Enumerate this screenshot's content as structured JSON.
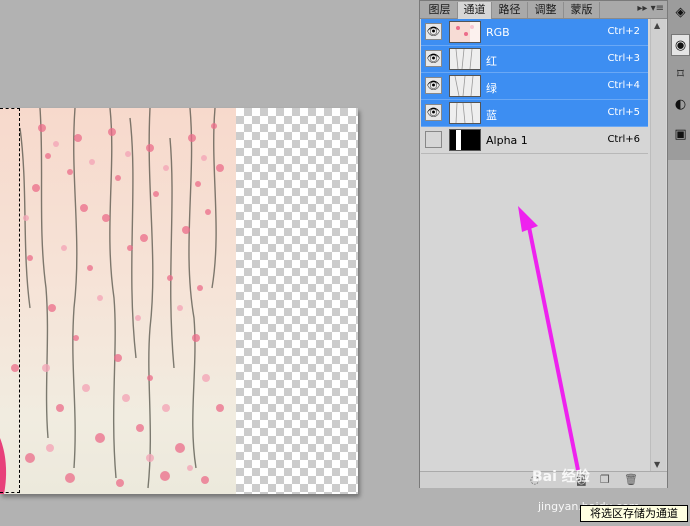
{
  "panel": {
    "tabs": [
      "图层",
      "通道",
      "路径",
      "调整",
      "蒙版"
    ],
    "active_tab": "通道",
    "menu_glyph": "▸▸ ▾≡",
    "channels": [
      {
        "name": "RGB",
        "shortcut": "Ctrl+2",
        "visible": true,
        "selected": true
      },
      {
        "name": "红",
        "shortcut": "Ctrl+3",
        "visible": true,
        "selected": true
      },
      {
        "name": "绿",
        "shortcut": "Ctrl+4",
        "visible": true,
        "selected": true
      },
      {
        "name": "蓝",
        "shortcut": "Ctrl+5",
        "visible": true,
        "selected": true
      },
      {
        "name": "Alpha 1",
        "shortcut": "Ctrl+6",
        "visible": false,
        "selected": false
      }
    ]
  },
  "tooltip": "将选区存储为通道",
  "watermark": {
    "brand": "Bai 经验",
    "url": "jingyan.baidu.com"
  },
  "colors": {
    "selection": "#3d8ef2",
    "arrow": "#ee22ee",
    "blossom": "#ec6d8a"
  },
  "icons": {
    "eye": "eye-icon",
    "save-selection": "save-selection-channel-icon",
    "delete": "trash-icon"
  }
}
